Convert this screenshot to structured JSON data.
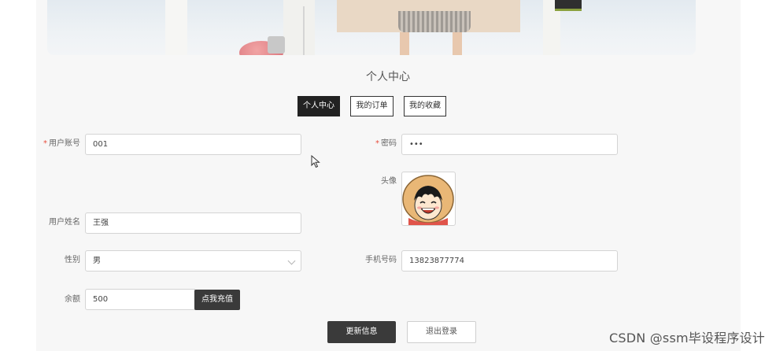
{
  "page": {
    "title": "个人中心"
  },
  "tabs": [
    {
      "label": "个人中心",
      "active": true
    },
    {
      "label": "我的订单",
      "active": false
    },
    {
      "label": "我的收藏",
      "active": false
    }
  ],
  "form": {
    "account": {
      "label": "用户账号",
      "required_mark": "*",
      "value": "001"
    },
    "password": {
      "label": "密码",
      "required_mark": "*",
      "value": "•••"
    },
    "avatar": {
      "label": "头像",
      "icon": "anime-avatar-icon"
    },
    "name": {
      "label": "用户姓名",
      "value": "王强"
    },
    "gender": {
      "label": "性别",
      "value": "男"
    },
    "phone": {
      "label": "手机号码",
      "value": "13823877774"
    },
    "balance": {
      "label": "余额",
      "value": "500"
    }
  },
  "buttons": {
    "recharge": "点我充值",
    "update": "更新信息",
    "logout": "退出登录"
  },
  "watermark": "CSDN @ssm毕设程序设计",
  "colors": {
    "accent_dark": "#222222",
    "button_dark": "#3a3a3a",
    "required": "#e74c3c",
    "panel_bg": "#f7f7f7"
  }
}
